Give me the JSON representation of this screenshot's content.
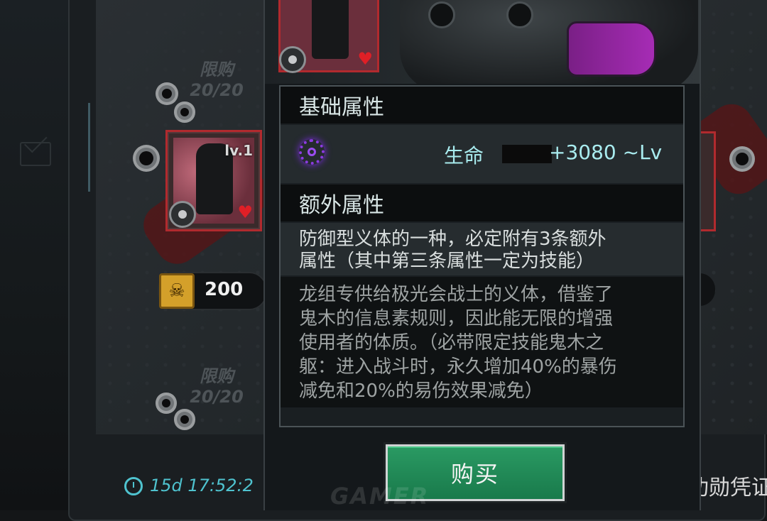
{
  "shop": {
    "limit_label_1": "限购",
    "limit_count_1": "20/20",
    "limit_label_2": "限购",
    "limit_count_2": "20/20",
    "item_level": "lv.1",
    "price": "200",
    "timer": "15d 17:52:2",
    "right_button_label": "功勋凭证"
  },
  "popup": {
    "basic_header": "基础属性",
    "basic_attr": {
      "name": "生命",
      "value": "+3080 ~Lv",
      "icon": "purple-ring-icon"
    },
    "extra_header": "额外属性",
    "extra_desc_line1": "防御型义体的一种，必定附有3条额外",
    "extra_desc_line2": "属性（其中第三条属性一定为技能）",
    "lore_line1": "龙组专供给极光会战士的义体，借鉴了",
    "lore_line2": "鬼木的信息素规则，因此能无限的增强",
    "lore_line3": "使用者的体质。（必带限定技能鬼木之",
    "lore_line4": "躯：进入战斗时，永久增加40%的暴伤",
    "lore_line5": "减免和20%的易伤效果减免）",
    "buy_label": "购买"
  },
  "colors": {
    "accent_cyan": "#a9ecef",
    "buy_green": "#2a9a63",
    "frame_red": "#b12a2e",
    "icon_purple": "#8b3be0"
  }
}
